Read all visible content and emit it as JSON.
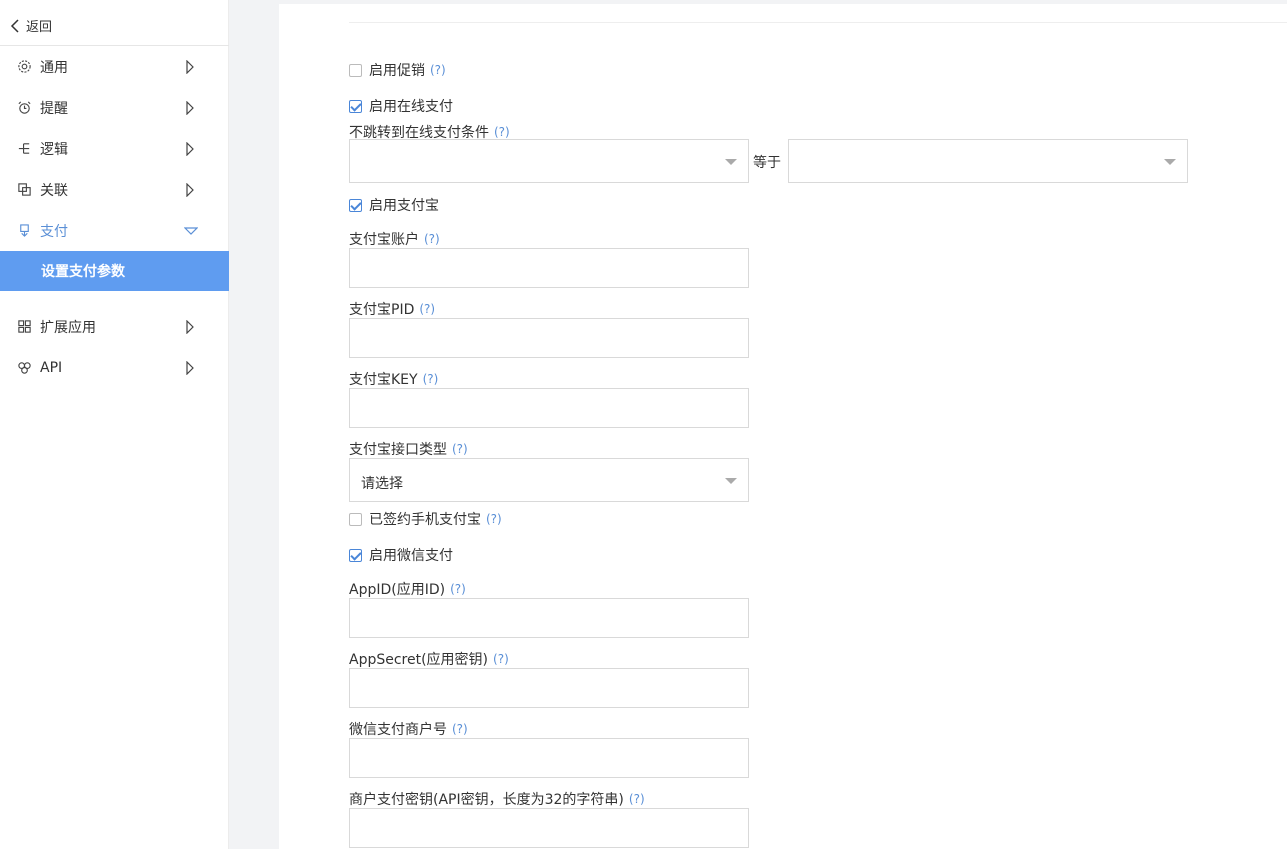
{
  "sidebar": {
    "back_label": "返回",
    "items": [
      {
        "label": "通用"
      },
      {
        "label": "提醒"
      },
      {
        "label": "逻辑"
      },
      {
        "label": "关联"
      },
      {
        "label": "支付"
      },
      {
        "label": "扩展应用"
      },
      {
        "label": "API"
      }
    ],
    "sub_item": "设置支付参数",
    "active_color": "#5a8fd6",
    "sub_bg": "#5f9cf0"
  },
  "form": {
    "help": "(?)",
    "enable_promo": "启用促销",
    "enable_online_pay": "启用在线支付",
    "no_redirect_label": "不跳转到在线支付条件",
    "equals": "等于",
    "enable_alipay": "启用支付宝",
    "alipay_account": "支付宝账户",
    "alipay_pid": "支付宝PID",
    "alipay_key": "支付宝KEY",
    "alipay_api_type": "支付宝接口类型",
    "alipay_api_type_value": "请选择",
    "signed_mobile_alipay": "已签约手机支付宝",
    "enable_wechat_pay": "启用微信支付",
    "app_id": "AppID(应用ID)",
    "app_secret": "AppSecret(应用密钥)",
    "wechat_merchant_no": "微信支付商户号",
    "merchant_key": "商户支付密钥(API密钥，长度为32的字符串)"
  },
  "checkboxes": {
    "promo": false,
    "online_pay": true,
    "alipay": true,
    "signed_mobile": false,
    "wechat": true
  }
}
